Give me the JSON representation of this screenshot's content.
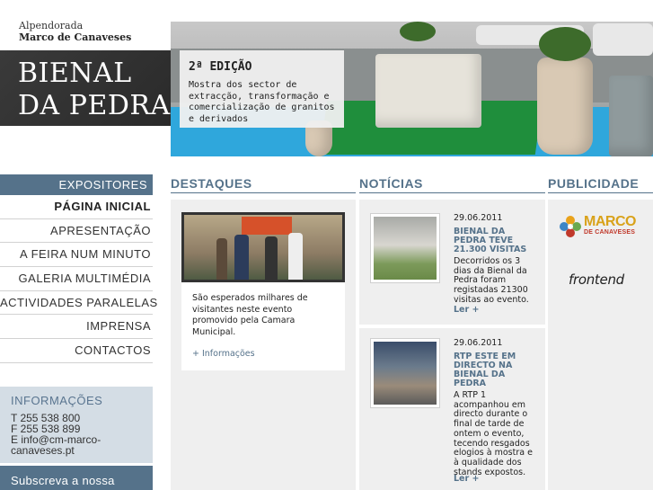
{
  "brand": {
    "line1": "Alpendorada",
    "line2": "Marco de Canaveses",
    "title1": "BIENAL",
    "title2": "DA PEDRA"
  },
  "hero": {
    "edition": "2ª EDIÇÃO",
    "description": "Mostra dos sector de extracção, transformação e comercialização de granitos e derivados"
  },
  "nav": {
    "items": [
      {
        "label": "EXPOSITORES"
      },
      {
        "label": "PÁGINA INICIAL"
      },
      {
        "label": "APRESENTAÇÃO"
      },
      {
        "label": "A FEIRA NUM MINUTO"
      },
      {
        "label": "GALERIA MULTIMÉDIA"
      },
      {
        "label": "ACTIVIDADES PARALELAS"
      },
      {
        "label": "IMPRENSA"
      },
      {
        "label": "CONTACTOS"
      }
    ]
  },
  "info": {
    "title": "INFORMAÇÕES",
    "phone": "T 255 538 800",
    "fax": "F 255 538 899",
    "email": "E info@cm-marco-canaveses.pt"
  },
  "subscribe": {
    "label": "Subscreva a nossa"
  },
  "sections": {
    "destaques": "DESTAQUES",
    "noticias": "NOTÍCIAS",
    "publicidade": "PUBLICIDADE"
  },
  "destaque": {
    "text": "São esperados milhares de visitantes neste evento promovido pela Camara Municipal.",
    "link": "+ Informações"
  },
  "news": [
    {
      "date": "29.06.2011",
      "title": "BIENAL DA PEDRA TEVE 21.300 VISITAS",
      "body": "Decorridos os 3 dias da Bienal da Pedra foram registadas 21300 visitas ao evento.",
      "more": "Ler +"
    },
    {
      "date": "29.06.2011",
      "title": "RTP ESTE EM DIRECTO NA BIENAL DA PEDRA",
      "body": "A RTP 1 acompanhou em directo durante o final de tarde de ontem o evento, tecendo resgados elogios à mostra e à qualidade dos stands expostos.",
      "more": "Ler +"
    }
  ],
  "ads": {
    "logo1_name": "MARCO",
    "logo1_sub": "DE CANAVESES",
    "logo2": "frontend"
  },
  "colors": {
    "accent": "#55728a",
    "brand_dark": "#2e2e2e",
    "panel": "#efefef",
    "info_panel": "#d4dde5"
  }
}
